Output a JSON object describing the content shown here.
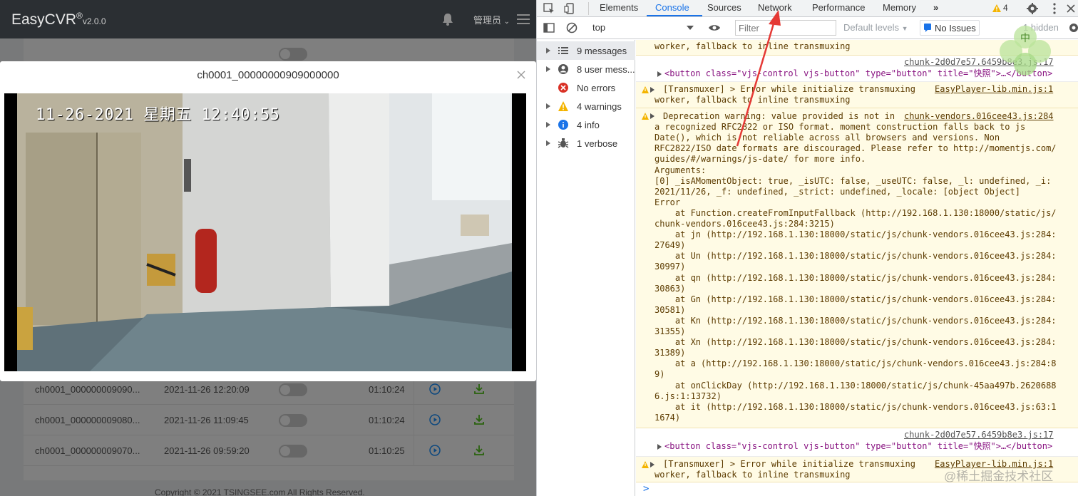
{
  "app": {
    "logo": "EasyCVR",
    "logo_reg": "®",
    "version": "v2.0.0",
    "user": "管理员",
    "rows": [
      {
        "name": "ch0001_000000009090...",
        "time": "2021-11-26 12:20:09",
        "duration": "01:10:24"
      },
      {
        "name": "ch0001_000000009080...",
        "time": "2021-11-26 11:09:45",
        "duration": "01:10:24"
      },
      {
        "name": "ch0001_000000009070...",
        "time": "2021-11-26 09:59:20",
        "duration": "01:10:25"
      }
    ],
    "copyright": "Copyright © 2021 TSINGSEE.com All Rights Reserved.",
    "modal": {
      "title": "ch0001_00000000909000000",
      "video_osd": "11-26-2021 星期五 12:40:55"
    },
    "colors": {
      "header": "#2b2f33",
      "accent": "#1890ff",
      "download": "#52c41a"
    }
  },
  "devtools": {
    "tabs": [
      "Elements",
      "Console",
      "Sources",
      "Network",
      "Performance",
      "Memory"
    ],
    "more_tabs": "»",
    "warning_count": "4",
    "context": "top",
    "filter_placeholder": "Filter",
    "levels": "Default levels",
    "no_issues": "No Issues",
    "hidden": "1 hidden",
    "sidebar": [
      {
        "label": "9 messages",
        "icon": "list-icon"
      },
      {
        "label": "8 user mess...",
        "icon": "user-icon"
      },
      {
        "label": "No errors",
        "icon": "error-icon"
      },
      {
        "label": "4 warnings",
        "icon": "warning-icon"
      },
      {
        "label": "4 info",
        "icon": "info-icon"
      },
      {
        "label": "1 verbose",
        "icon": "bug-icon"
      }
    ],
    "console": {
      "m0_line": "worker, fallback to inline transmuxing",
      "m1_src": "chunk-2d0d7e57.6459b8e3.js:17",
      "m1_tag_open": "<button class=\"vjs-control vjs-button\" type=\"button\" title=\"快照\">…</button>",
      "m2_line1": "[Transmuxer] > Error while initialize transmuxing",
      "m2_src": "EasyPlayer-lib.min.js:1",
      "m2_line2": "worker, fallback to inline transmuxing",
      "m3_src": "chunk-vendors.016cee43.js:284",
      "m3_lines": [
        "Deprecation warning: value provided is not in",
        "a recognized RFC2822 or ISO format. moment construction falls back to js",
        "Date(), which is not reliable across all browsers and versions. Non",
        "RFC2822/ISO date formats are discouraged. Please refer to http://momentjs.com/",
        "guides/#/warnings/js-date/ for more info.",
        "Arguments:",
        "[0] _isAMomentObject: true, _isUTC: false, _useUTC: false, _l: undefined, _i:",
        "2021/11/26, _f: undefined, _strict: undefined, _locale: [object Object]",
        "Error",
        "    at Function.createFromInputFallback (http://192.168.1.130:18000/static/js/",
        "chunk-vendors.016cee43.js:284:3215)",
        "    at jn (http://192.168.1.130:18000/static/js/chunk-vendors.016cee43.js:284:",
        "27649)",
        "    at Un (http://192.168.1.130:18000/static/js/chunk-vendors.016cee43.js:284:",
        "30997)",
        "    at qn (http://192.168.1.130:18000/static/js/chunk-vendors.016cee43.js:284:",
        "30863)",
        "    at Gn (http://192.168.1.130:18000/static/js/chunk-vendors.016cee43.js:284:",
        "30581)",
        "    at Kn (http://192.168.1.130:18000/static/js/chunk-vendors.016cee43.js:284:",
        "31355)",
        "    at Xn (http://192.168.1.130:18000/static/js/chunk-vendors.016cee43.js:284:",
        "31389)",
        "    at a (http://192.168.1.130:18000/static/js/chunk-vendors.016cee43.js:284:8",
        "9)",
        "    at onClickDay (http://192.168.1.130:18000/static/js/chunk-45aa497b.2620688",
        "6.js:1:13732)",
        "    at it (http://192.168.1.130:18000/static/js/chunk-vendors.016cee43.js:63:1",
        "1674)"
      ],
      "m4_src": "chunk-2d0d7e57.6459b8e3.js:17",
      "m4_tag_open": "<button class=\"vjs-control vjs-button\" type=\"button\" title=\"快照\">…</button>",
      "m5_line1": "[Transmuxer] > Error while initialize transmuxing",
      "m5_src": "EasyPlayer-lib.min.js:1",
      "m5_line2": "worker, fallback to inline transmuxing",
      "prompt": ">"
    }
  },
  "watermark": "@稀土掘金技术社区",
  "clover_char": "中"
}
